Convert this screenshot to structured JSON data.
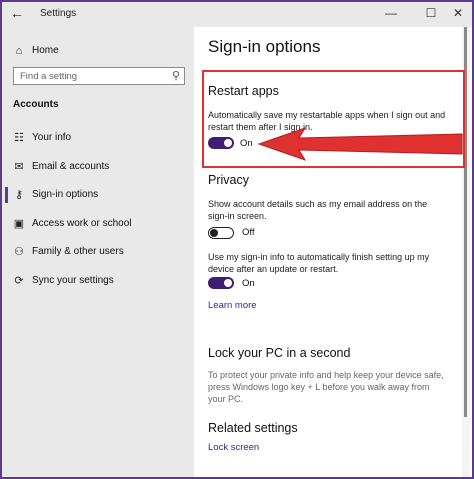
{
  "titlebar": {
    "title": "Settings",
    "back_glyph": "←",
    "minimize_glyph": "—",
    "maximize_glyph": "☐",
    "close_glyph": "✕"
  },
  "sidebar": {
    "home": {
      "label": "Home",
      "icon": "home-icon"
    },
    "search": {
      "placeholder": "Find a setting"
    },
    "section_heading": "Accounts",
    "items": [
      {
        "label": "Your info",
        "icon": "person-card-icon",
        "active": false
      },
      {
        "label": "Email & accounts",
        "icon": "mail-icon",
        "active": false
      },
      {
        "label": "Sign-in options",
        "icon": "key-icon",
        "active": true
      },
      {
        "label": "Access work or school",
        "icon": "briefcase-icon",
        "active": false
      },
      {
        "label": "Family & other users",
        "icon": "people-icon",
        "active": false
      },
      {
        "label": "Sync your settings",
        "icon": "sync-icon",
        "active": false
      }
    ]
  },
  "main": {
    "page_title": "Sign-in options",
    "restart_apps": {
      "heading": "Restart apps",
      "description": "Automatically save my restartable apps when I sign out and restart them after I sign in.",
      "toggle_state": "On"
    },
    "privacy": {
      "heading": "Privacy",
      "account_details_text": "Show account details such as my email address on the sign-in screen.",
      "account_details_state": "Off",
      "signin_info_text": "Use my sign-in info to automatically finish setting up my device after an update or restart.",
      "signin_info_state": "On",
      "learn_more": "Learn more"
    },
    "lock_pc": {
      "heading": "Lock your PC in a second",
      "text": "To protect your private info and help keep your device safe, press Windows logo key + L before you walk away from your PC."
    },
    "related": {
      "heading": "Related settings",
      "link": "Lock screen"
    }
  },
  "colors": {
    "accent": "#3c1f73",
    "highlight": "#e03131",
    "sidebar_bg": "#e9e9e9",
    "link": "#3a1f8a"
  }
}
